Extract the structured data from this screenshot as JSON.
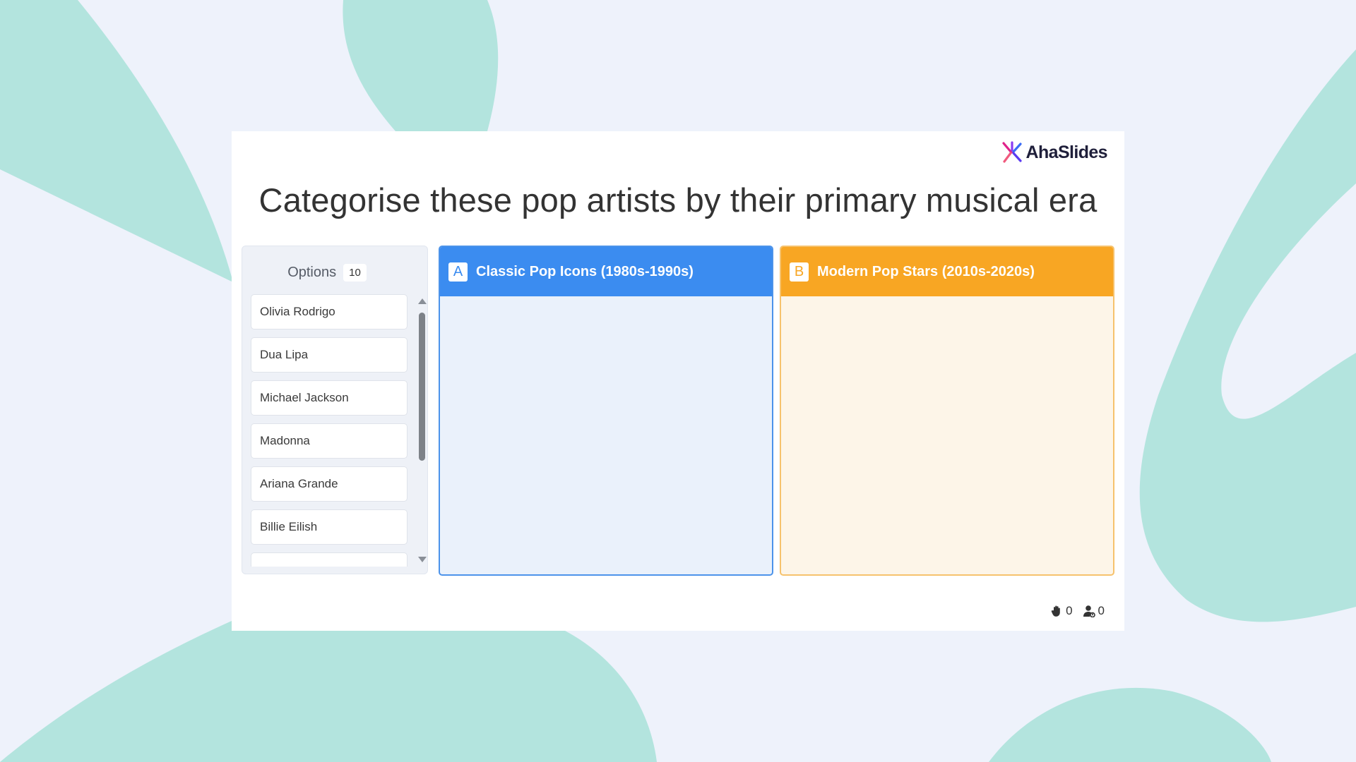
{
  "colors": {
    "background": "#eef2fb",
    "blob": "#b3e4de",
    "category_a": "#3b8cf0",
    "category_b": "#f8a623"
  },
  "brand": {
    "name": "AhaSlides",
    "logo_icon": "ahaslides-logo-icon"
  },
  "title": "Categorise these pop artists by their primary musical era",
  "options": {
    "label": "Options",
    "count": "10",
    "items": [
      "Olivia Rodrigo",
      "Dua Lipa",
      "Michael Jackson",
      "Madonna",
      "Ariana Grande",
      "Billie Eilish",
      ""
    ]
  },
  "categories": [
    {
      "letter": "A",
      "name": "Classic Pop Icons (1980s-1990s)"
    },
    {
      "letter": "B",
      "name": "Modern Pop Stars (2010s-2020s)"
    }
  ],
  "stats": {
    "reactions": {
      "icon": "hand-icon",
      "count": "0"
    },
    "participants": {
      "icon": "user-icon",
      "count": "0"
    }
  }
}
